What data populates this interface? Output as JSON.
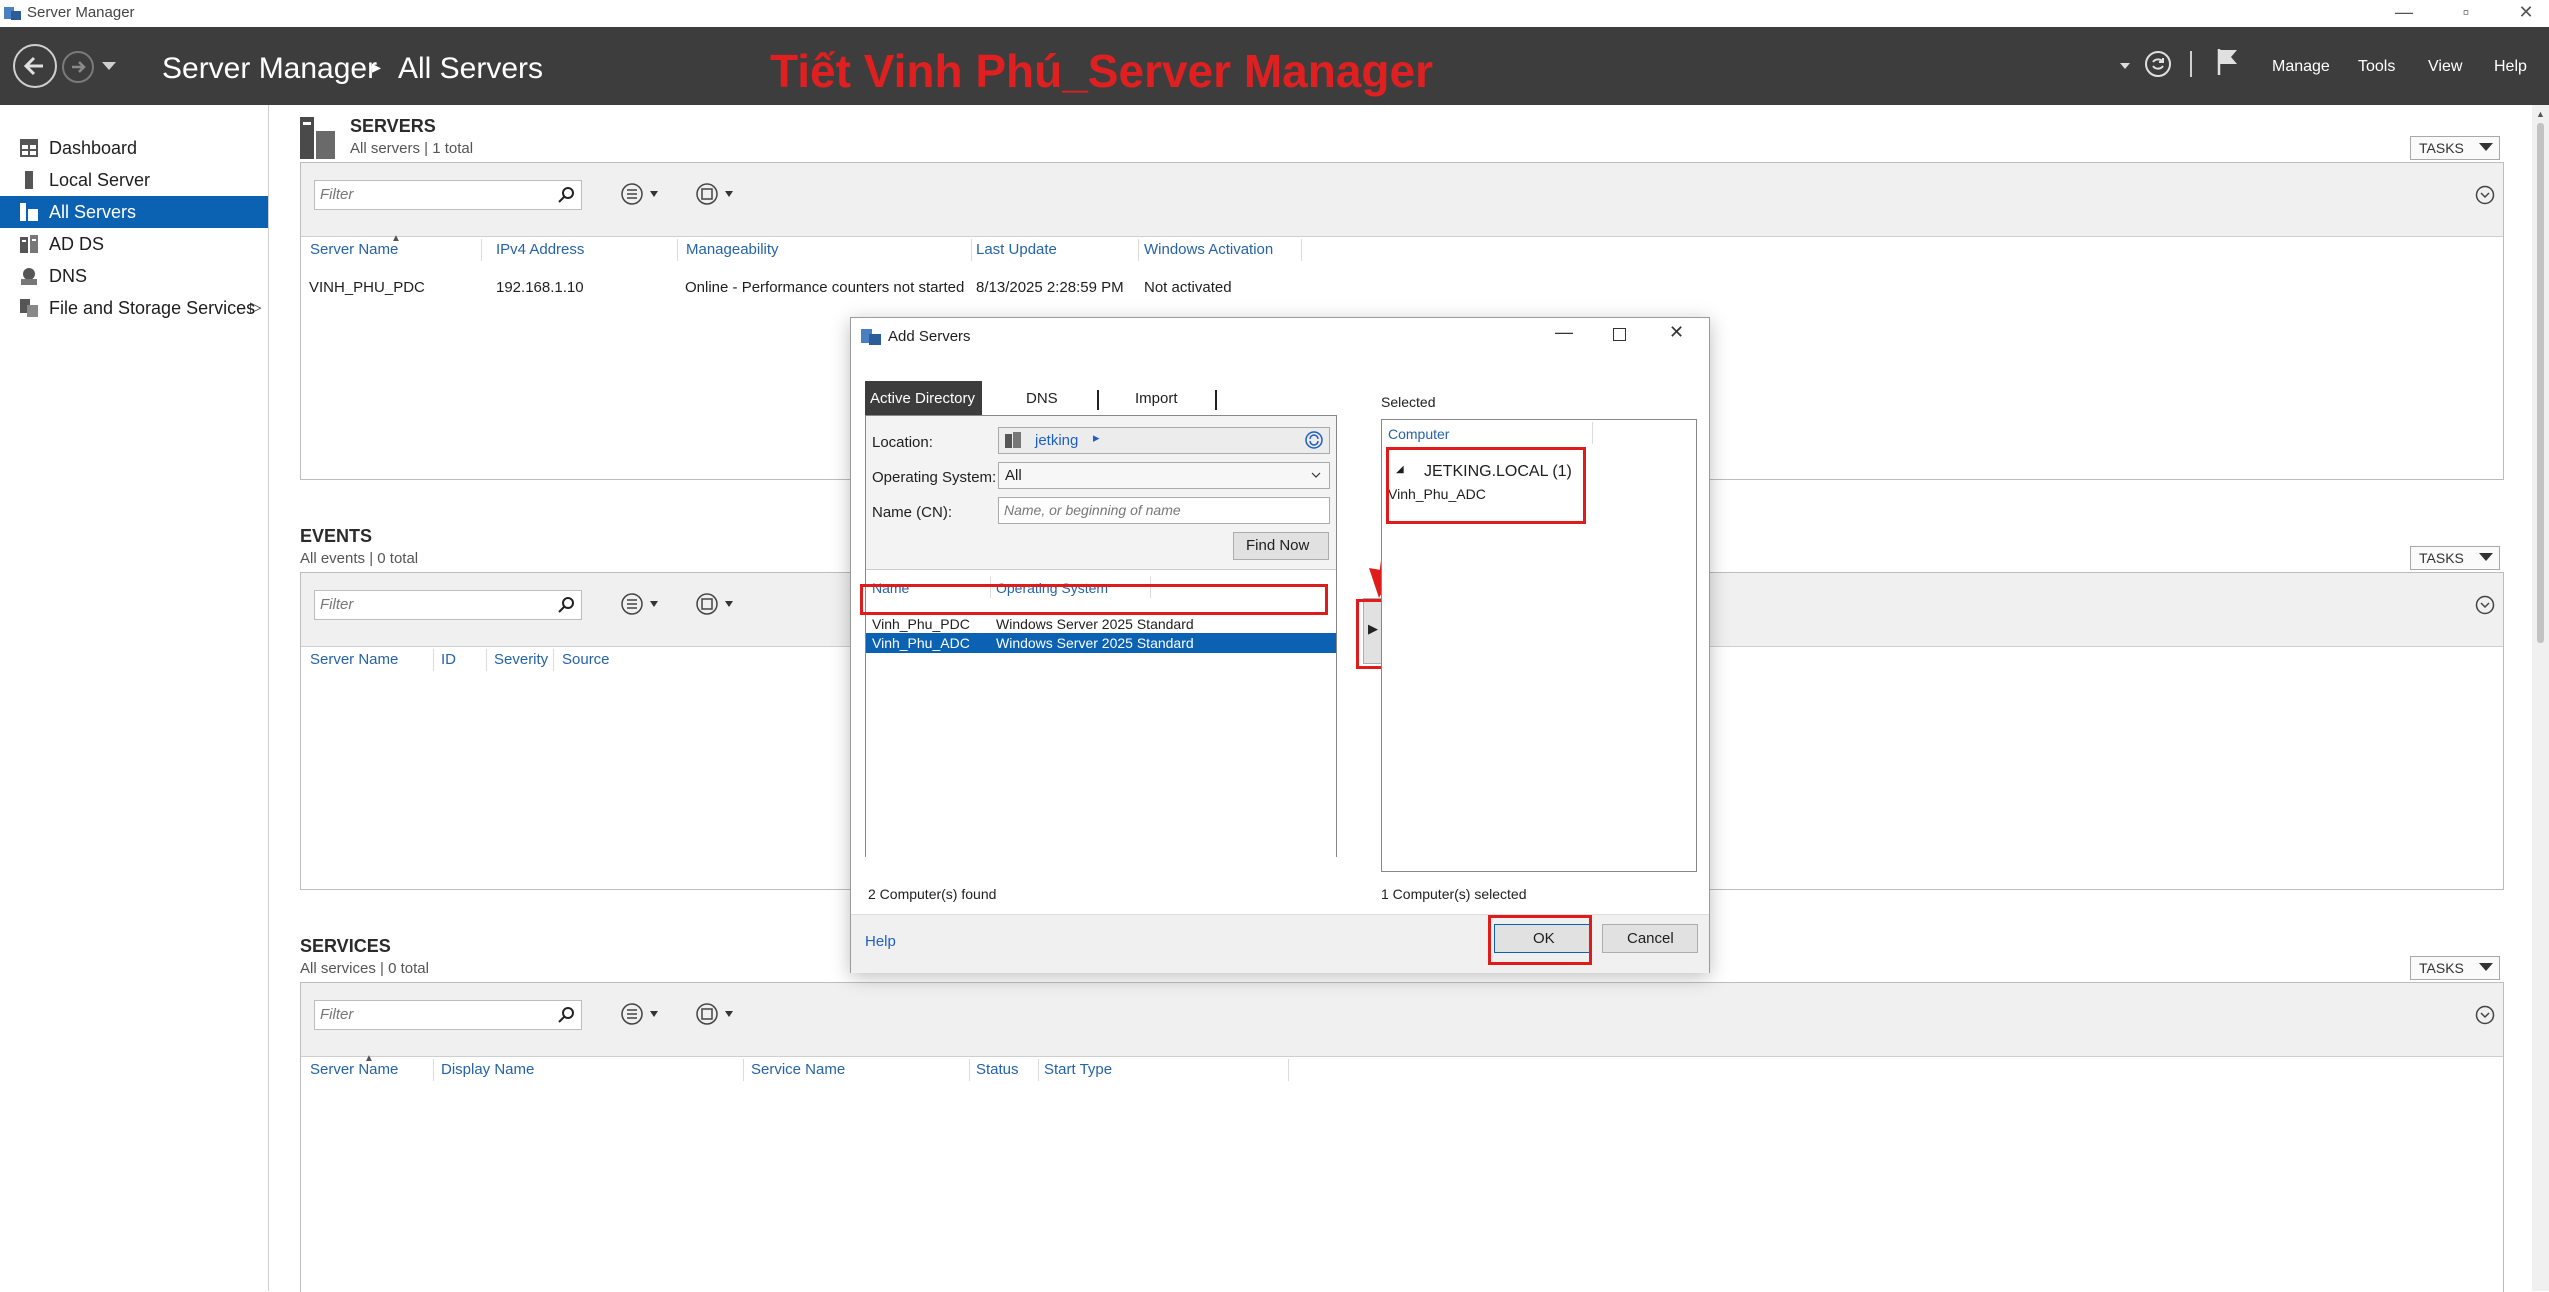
{
  "window": {
    "title": "Server Manager",
    "controls": [
      "—",
      "▫",
      "✕"
    ]
  },
  "header": {
    "breadcrumb_root": "Server Manager",
    "breadcrumb_sep": "▸",
    "breadcrumb_page": "All Servers",
    "overlay_title": "Tiết Vinh Phú_Server Manager",
    "menu": {
      "manage": "Manage",
      "tools": "Tools",
      "view": "View",
      "help": "Help"
    }
  },
  "sidebar": {
    "items": [
      {
        "label": "Dashboard",
        "icon": "dashboard-icon"
      },
      {
        "label": "Local Server",
        "icon": "local-server-icon"
      },
      {
        "label": "All Servers",
        "icon": "all-servers-icon",
        "active": true
      },
      {
        "label": "AD DS",
        "icon": "adds-icon"
      },
      {
        "label": "DNS",
        "icon": "dns-icon"
      },
      {
        "label": "File and Storage Services",
        "icon": "file-storage-icon",
        "expand": "▷"
      }
    ]
  },
  "servers": {
    "title": "SERVERS",
    "subtitle": "All servers | 1 total",
    "tasks": "TASKS",
    "filter_placeholder": "Filter",
    "columns": [
      "Server Name",
      "IPv4 Address",
      "Manageability",
      "Last Update",
      "Windows Activation"
    ],
    "rows": [
      [
        "VINH_PHU_PDC",
        "192.168.1.10",
        "Online - Performance counters not started",
        "8/13/2025 2:28:59 PM",
        "Not activated"
      ]
    ]
  },
  "events": {
    "title": "EVENTS",
    "subtitle": "All events | 0 total",
    "tasks": "TASKS",
    "filter_placeholder": "Filter",
    "columns": [
      "Server Name",
      "ID",
      "Severity",
      "Source"
    ]
  },
  "services": {
    "title": "SERVICES",
    "subtitle": "All services | 0 total",
    "tasks": "TASKS",
    "filter_placeholder": "Filter",
    "columns": [
      "Server Name",
      "Display Name",
      "Service Name",
      "Status",
      "Start Type"
    ]
  },
  "dialog": {
    "title": "Add Servers",
    "tabs": [
      "Active Directory",
      "DNS",
      "Import"
    ],
    "location_label": "Location:",
    "location_value": "jetking",
    "os_label": "Operating System:",
    "os_value": "All",
    "name_label": "Name (CN):",
    "name_placeholder": "Name, or beginning of name",
    "find_now": "Find Now",
    "results_columns": [
      "Name",
      "Operating System"
    ],
    "results": [
      {
        "name": "Vinh_Phu_PDC",
        "os": "Windows Server 2025 Standard"
      },
      {
        "name": "Vinh_Phu_ADC",
        "os": "Windows Server 2025 Standard",
        "selected": true
      }
    ],
    "found_text": "2 Computer(s) found",
    "add_arrow": "▶",
    "selected_label": "Selected",
    "selected_column": "Computer",
    "selected_group": "JETKING.LOCAL (1)",
    "selected_item": "Vinh_Phu_ADC",
    "selected_count": "1 Computer(s) selected",
    "help": "Help",
    "ok": "OK",
    "cancel": "Cancel"
  },
  "colors": {
    "header_bg": "#3d3d3d",
    "accent": "#0b62b3",
    "link": "#2563a8",
    "annotation_red": "#e01b1b"
  }
}
